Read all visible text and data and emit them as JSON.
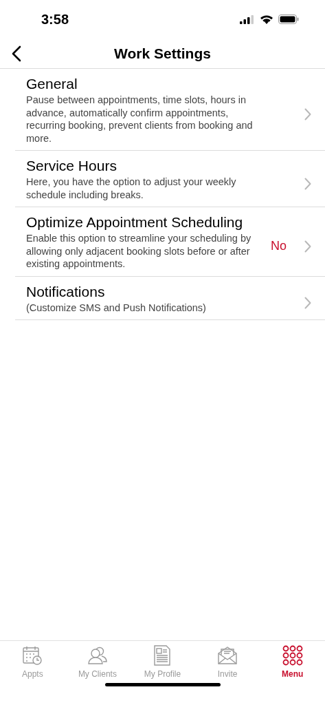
{
  "status_bar": {
    "time": "3:58"
  },
  "header": {
    "title": "Work Settings"
  },
  "settings": [
    {
      "title": "General",
      "description": "Pause between appointments, time slots, hours in advance, automatically confirm appointments, recurring booking, prevent clients from booking and more."
    },
    {
      "title": "Service Hours",
      "description": "Here, you have the option to adjust your weekly schedule including breaks."
    },
    {
      "title": "Optimize Appointment Scheduling",
      "description": "Enable this option to streamline your scheduling by allowing only adjacent booking slots before or after existing appointments.",
      "value": "No"
    },
    {
      "title": "Notifications",
      "description": "(Customize SMS and Push Notifications)"
    }
  ],
  "tab_bar": [
    {
      "kind": "calendar",
      "label": "Appts",
      "selected": false
    },
    {
      "kind": "people",
      "label": "My Clients",
      "selected": false
    },
    {
      "kind": "profile",
      "label": "My Profile",
      "selected": false
    },
    {
      "kind": "envelope",
      "label": "Invite",
      "selected": false
    },
    {
      "kind": "grid",
      "label": "Menu",
      "selected": true
    }
  ]
}
